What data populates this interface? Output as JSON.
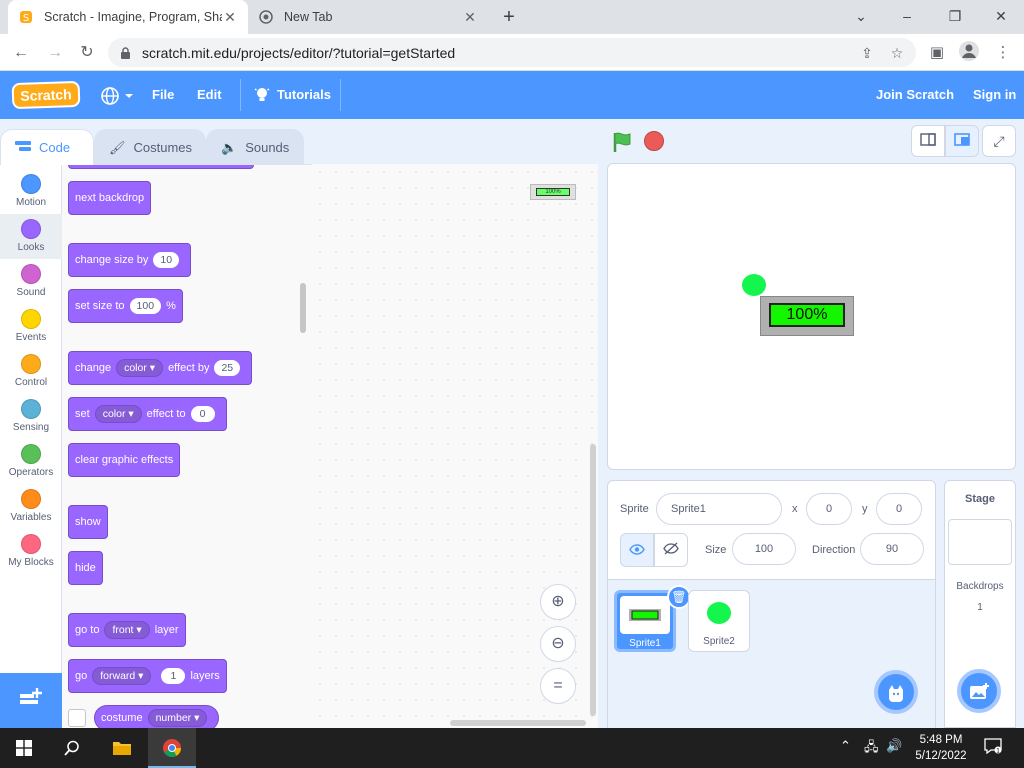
{
  "browser": {
    "tabs": [
      {
        "title": "Scratch - Imagine, Program, Shar",
        "active": true
      },
      {
        "title": "New Tab",
        "active": false
      }
    ],
    "url": "scratch.mit.edu/projects/editor/?tutorial=getStarted"
  },
  "menubar": {
    "logo": "Scratch",
    "file": "File",
    "edit": "Edit",
    "tutorials": "Tutorials",
    "join": "Join Scratch",
    "signin": "Sign in"
  },
  "editor_tabs": {
    "code": "Code",
    "costumes": "Costumes",
    "sounds": "Sounds"
  },
  "categories": [
    {
      "label": "Motion",
      "color": "#4c97ff"
    },
    {
      "label": "Looks",
      "color": "#9966ff"
    },
    {
      "label": "Sound",
      "color": "#cf63cf"
    },
    {
      "label": "Events",
      "color": "#ffd500"
    },
    {
      "label": "Control",
      "color": "#ffab19"
    },
    {
      "label": "Sensing",
      "color": "#5cb1d6"
    },
    {
      "label": "Operators",
      "color": "#59c059"
    },
    {
      "label": "Variables",
      "color": "#ff8c1a"
    },
    {
      "label": "My Blocks",
      "color": "#ff6680"
    }
  ],
  "blocks": {
    "next_backdrop": "next backdrop",
    "change_size": {
      "text": "change size by",
      "value": "10"
    },
    "set_size": {
      "text": "set size to",
      "value": "100",
      "suffix": "%"
    },
    "change_effect": {
      "text": "change",
      "dropdown": "color",
      "mid": "effect by",
      "value": "25"
    },
    "set_effect": {
      "text": "set",
      "dropdown": "color",
      "mid": "effect to",
      "value": "0"
    },
    "clear_effects": "clear graphic effects",
    "show": "show",
    "hide": "hide",
    "go_to_layer": {
      "text": "go to",
      "dropdown": "front",
      "suffix": "layer"
    },
    "go_layers": {
      "text": "go",
      "dropdown": "forward",
      "value": "1",
      "suffix": "layers"
    },
    "costume": {
      "text": "costume",
      "dropdown": "number"
    }
  },
  "monitor": {
    "label": "100%"
  },
  "sprite_info": {
    "sprite_label": "Sprite",
    "sprite_name": "Sprite1",
    "x_label": "x",
    "x_value": "0",
    "y_label": "y",
    "y_value": "0",
    "size_label": "Size",
    "size_value": "100",
    "direction_label": "Direction",
    "direction_value": "90"
  },
  "sprites": [
    {
      "name": "Sprite1",
      "selected": true
    },
    {
      "name": "Sprite2",
      "selected": false
    }
  ],
  "stage_panel": {
    "title": "Stage",
    "backdrops_label": "Backdrops",
    "backdrops_count": "1"
  },
  "taskbar": {
    "time": "5:48 PM",
    "date": "5/12/2022"
  }
}
